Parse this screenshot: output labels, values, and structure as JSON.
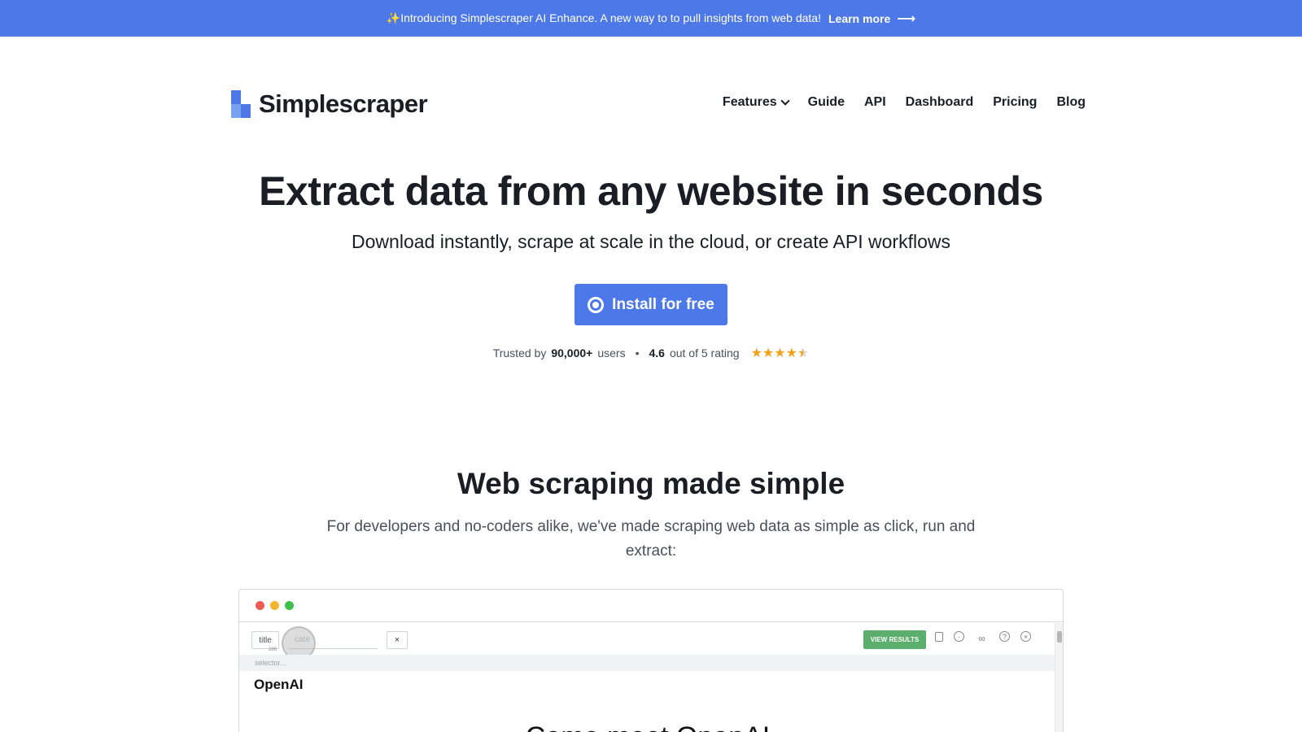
{
  "announcement": {
    "text": "✨Introducing Simplescraper AI Enhance. A new way to to pull insights from web data!",
    "link_label": "Learn more",
    "link_icon": "arrow-right-icon",
    "background": "#4d78e8"
  },
  "header": {
    "brand": "Simplescraper",
    "nav": [
      {
        "label": "Features",
        "has_dropdown": true
      },
      {
        "label": "Guide"
      },
      {
        "label": "API"
      },
      {
        "label": "Dashboard"
      },
      {
        "label": "Pricing"
      },
      {
        "label": "Blog"
      }
    ]
  },
  "hero": {
    "title": "Extract data from any website in seconds",
    "subtitle": "Download instantly, scrape at scale in the cloud, or create API workflows",
    "cta_label": "Install for free",
    "cta_icon": "chrome-icon",
    "trust": {
      "prefix": "Trusted by",
      "users": "90,000+",
      "users_suffix": "users",
      "separator": "•",
      "rating": "4.6",
      "rating_suffix": "out of 5 rating",
      "stars": 4.5
    }
  },
  "section": {
    "title": "Web scraping made simple",
    "description": "For developers and no-coders alike, we've made scraping web data as simple as click, run and extract:"
  },
  "demo": {
    "field_label": "title",
    "field_count": "286",
    "field2_placeholder": "cate",
    "close_label": "×",
    "view_results_label": "VIEW RESULTS",
    "selector_placeholder": "selector...",
    "site_logo": "OpenAI",
    "site_heading": "Come meet OpenAI",
    "tool_icons": [
      "copy-icon",
      "palette-icon",
      "infinity-icon",
      "help-icon",
      "close-circle-icon"
    ]
  }
}
